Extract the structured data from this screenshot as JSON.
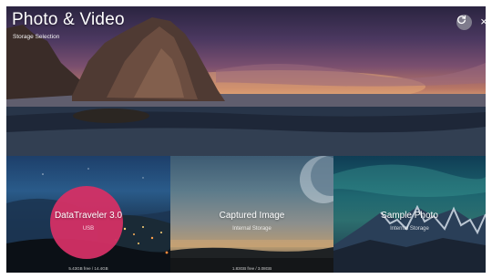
{
  "header": {
    "title": "Photo & Video",
    "subtitle": "Storage Selection",
    "refresh_icon": "refresh-icon",
    "close_label": "×"
  },
  "storages": [
    {
      "name": "DataTraveler 3.0",
      "type": "USB",
      "capacity": "5.43GB free / 14.4GB",
      "focused": true
    },
    {
      "name": "Captured Image",
      "type": "Internal Storage",
      "capacity": "1.83GB free / 3.08GB",
      "focused": false
    },
    {
      "name": "Sample Photo",
      "type": "Internal Storage",
      "capacity": "",
      "focused": false
    }
  ],
  "colors": {
    "focus": "#d43065",
    "text": "#ffffff"
  }
}
